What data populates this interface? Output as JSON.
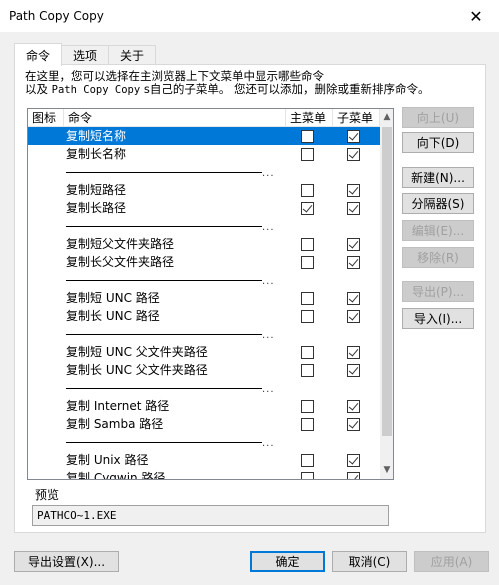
{
  "window": {
    "title": "Path Copy Copy",
    "close_glyph": "✕"
  },
  "tabs": [
    {
      "label": "命令",
      "active": true
    },
    {
      "label": "选项",
      "active": false
    },
    {
      "label": "关于",
      "active": false
    }
  ],
  "description": {
    "line1": "在这里，您可以选择在主浏览器上下文菜单中显示哪些命令",
    "line2_prefix": "以及",
    "line2_mono": "Path Copy Copy",
    "line2_suffix": "s自己的子菜单。 您还可以添加，删除或重新排序命令。"
  },
  "list": {
    "columns": {
      "icon": "图标",
      "command": "命令",
      "main": "主菜单",
      "sub": "子菜单"
    },
    "separator_dots": "...",
    "rows": [
      {
        "type": "item",
        "name": "复制短名称",
        "main": false,
        "sub": true,
        "selected": true
      },
      {
        "type": "item",
        "name": "复制长名称",
        "main": false,
        "sub": true,
        "selected": false
      },
      {
        "type": "sep"
      },
      {
        "type": "item",
        "name": "复制短路径",
        "main": false,
        "sub": true,
        "selected": false
      },
      {
        "type": "item",
        "name": "复制长路径",
        "main": true,
        "sub": true,
        "selected": false
      },
      {
        "type": "sep"
      },
      {
        "type": "item",
        "name": "复制短父文件夹路径",
        "main": false,
        "sub": true,
        "selected": false
      },
      {
        "type": "item",
        "name": "复制长父文件夹路径",
        "main": false,
        "sub": true,
        "selected": false
      },
      {
        "type": "sep"
      },
      {
        "type": "item",
        "name": "复制短 UNC 路径",
        "main": false,
        "sub": true,
        "selected": false
      },
      {
        "type": "item",
        "name": "复制长 UNC 路径",
        "main": false,
        "sub": true,
        "selected": false
      },
      {
        "type": "sep"
      },
      {
        "type": "item",
        "name": "复制短 UNC 父文件夹路径",
        "main": false,
        "sub": true,
        "selected": false
      },
      {
        "type": "item",
        "name": "复制长 UNC 父文件夹路径",
        "main": false,
        "sub": true,
        "selected": false
      },
      {
        "type": "sep"
      },
      {
        "type": "item",
        "name": "复制 Internet 路径",
        "main": false,
        "sub": true,
        "selected": false
      },
      {
        "type": "item",
        "name": "复制 Samba 路径",
        "main": false,
        "sub": true,
        "selected": false
      },
      {
        "type": "sep"
      },
      {
        "type": "item",
        "name": "复制 Unix 路径",
        "main": false,
        "sub": true,
        "selected": false
      },
      {
        "type": "item",
        "name": "复制 Cygwin 路径",
        "main": false,
        "sub": true,
        "selected": false
      }
    ]
  },
  "side_buttons": {
    "up": "向上(U)",
    "down": "向下(D)",
    "new": "新建(N)...",
    "separator": "分隔器(S)",
    "edit": "编辑(E)...",
    "remove": "移除(R)",
    "export": "导出(P)...",
    "import": "导入(I)..."
  },
  "preview": {
    "label": "预览",
    "value": "PATHCO~1.EXE"
  },
  "bottom_buttons": {
    "export_settings": "导出设置(X)...",
    "ok": "确定",
    "cancel": "取消(C)",
    "apply": "应用(A)"
  },
  "colors": {
    "selection": "#0078d7",
    "background": "#f0f0f0"
  }
}
